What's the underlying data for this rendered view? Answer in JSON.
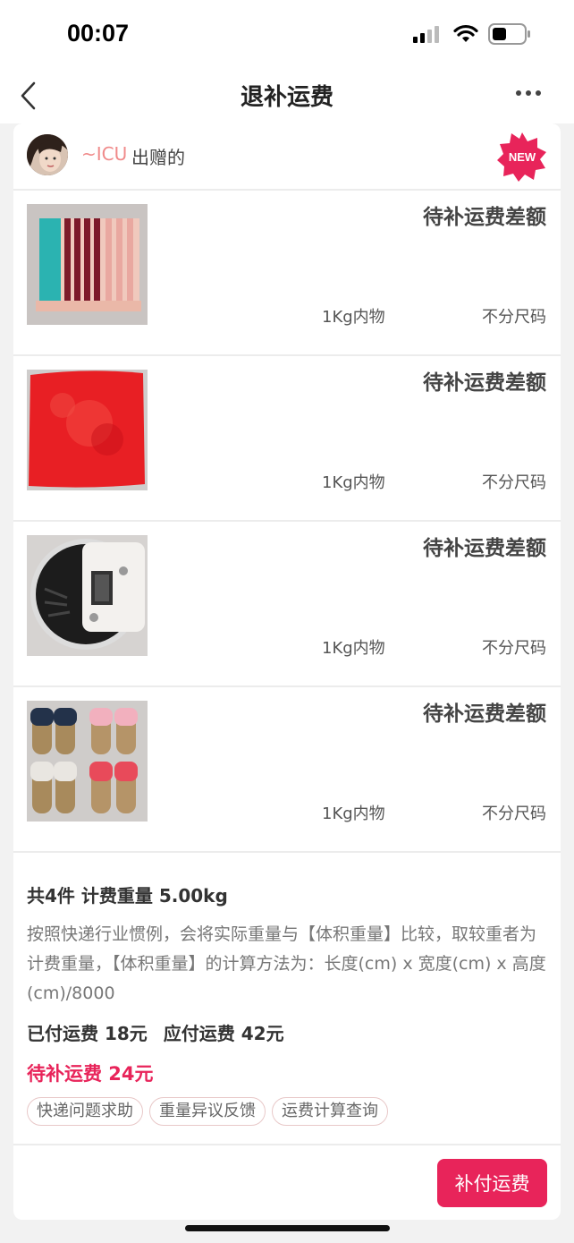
{
  "status_bar": {
    "time": "00:07"
  },
  "nav": {
    "title": "退补运费"
  },
  "seller": {
    "name": "~ICU",
    "suffix": "出赠的",
    "badge": "NEW"
  },
  "items": [
    {
      "status": "待补运费差额",
      "weight": "1Kg内物",
      "size": "不分尺码"
    },
    {
      "status": "待补运费差额",
      "weight": "1Kg内物",
      "size": "不分尺码"
    },
    {
      "status": "待补运费差额",
      "weight": "1Kg内物",
      "size": "不分尺码"
    },
    {
      "status": "待补运费差额",
      "weight": "1Kg内物",
      "size": "不分尺码"
    }
  ],
  "summary": {
    "count_line": "共4件  计费重量 5.00kg",
    "description": "按照快递行业惯例，会将实际重量与【体积重量】比较，取较重者为计费重量，【体积重量】的计算方法为：长度(cm) x 宽度(cm) x 高度(cm)/8000",
    "paid": "已付运费 18元",
    "due": "应付运费 42元",
    "pending": "待补运费 24元"
  },
  "chips": [
    "快递问题求助",
    "重量异议反馈",
    "运费计算查询"
  ],
  "pay_button": "补付运费",
  "colors": {
    "accent": "#e8245a",
    "seller_name": "#f08a8a"
  }
}
